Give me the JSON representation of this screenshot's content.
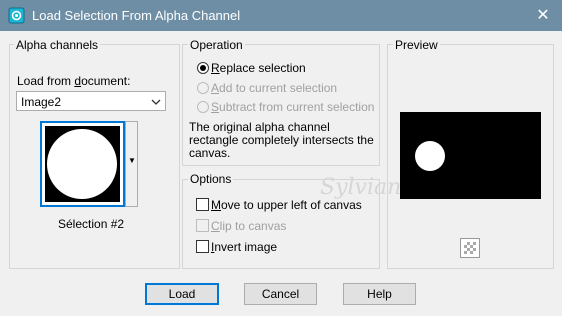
{
  "window": {
    "title": "Load Selection From Alpha Channel",
    "close_glyph": "✕",
    "app_icon": "paintshop-app-icon"
  },
  "alpha_channels": {
    "label": "Alpha channels",
    "load_from_label_pre": "Load from ",
    "load_from_label_u": "d",
    "load_from_label_post": "ocument:",
    "document_value": "Image2",
    "dropdown_icon": "chevron-down-icon",
    "thumb_dropdown_glyph": "▼",
    "channel_name": "Sélection #2"
  },
  "operation": {
    "label": "Operation",
    "options": [
      {
        "u": "R",
        "rest": "eplace selection",
        "selected": true,
        "enabled": true
      },
      {
        "u": "A",
        "rest": "dd to current selection",
        "selected": false,
        "enabled": false
      },
      {
        "u": "S",
        "rest": "ubtract from current selection",
        "selected": false,
        "enabled": false
      }
    ],
    "note_line1": "The original alpha channel",
    "note_line2": "rectangle completely intersects the",
    "note_line3": "canvas."
  },
  "options": {
    "label": "Options",
    "checks": [
      {
        "u": "M",
        "rest": "ove to upper left of canvas",
        "checked": false,
        "enabled": true
      },
      {
        "u": "C",
        "rest": "lip to canvas",
        "checked": false,
        "enabled": false
      },
      {
        "u": "I",
        "rest": "nvert image",
        "checked": false,
        "enabled": true
      }
    ]
  },
  "preview": {
    "label": "Preview",
    "zoom_icon": "checkerboard-icon"
  },
  "buttons": {
    "load": "Load",
    "cancel": "Cancel",
    "help": "Help"
  },
  "watermark": "Sylviane"
}
